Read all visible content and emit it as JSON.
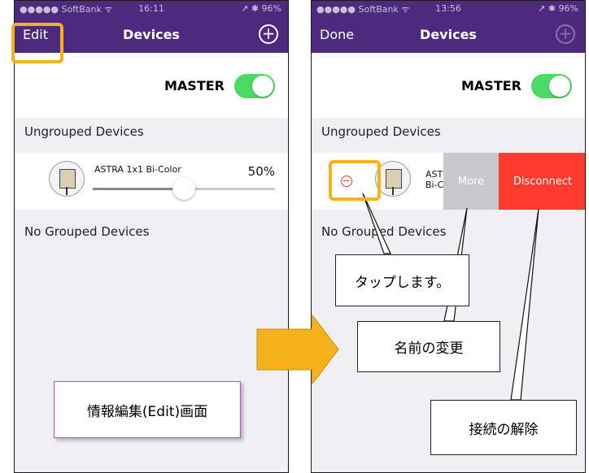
{
  "left_screen": {
    "status": {
      "carrier": "●●●●● SoftBank ᯤ",
      "time": "16:11",
      "right": "↗ ✱ 96%"
    },
    "nav": {
      "left_label": "Edit",
      "title": "Devices",
      "add_icon": "plus-circle-icon"
    },
    "master_label": "MASTER",
    "master_on": true,
    "ungrouped_title": "Ungrouped Devices",
    "device": {
      "name": "ASTRA 1x1 Bi-Color",
      "percent": "50%",
      "level": 0.5
    },
    "grouped_title": "No Grouped Devices",
    "info_box": "情報編集(Edit)画面"
  },
  "right_screen": {
    "status": {
      "carrier": "●●●●● SoftBank ᯤ",
      "time": "13:56",
      "right": "↗ ✱ 96%"
    },
    "nav": {
      "left_label": "Done",
      "title": "Devices",
      "add_icon": "plus-circle-icon"
    },
    "master_label": "MASTER",
    "master_on": true,
    "ungrouped_title": "Ungrouped Devices",
    "device": {
      "name_line1": "AST",
      "name_line2": "Bi-C"
    },
    "action_more": "More",
    "action_disconnect": "Disconnect",
    "grouped_title": "No Grouped Devices"
  },
  "callouts": {
    "tap": "タップします。",
    "rename": "名前の変更",
    "disconnect": "接続の解除"
  },
  "colors": {
    "nav_bg": "#4d2a7e",
    "toggle_on": "#4cd964",
    "highlight": "#f5b21b",
    "disconnect": "#ff3b30",
    "more": "#c7c7cc"
  }
}
